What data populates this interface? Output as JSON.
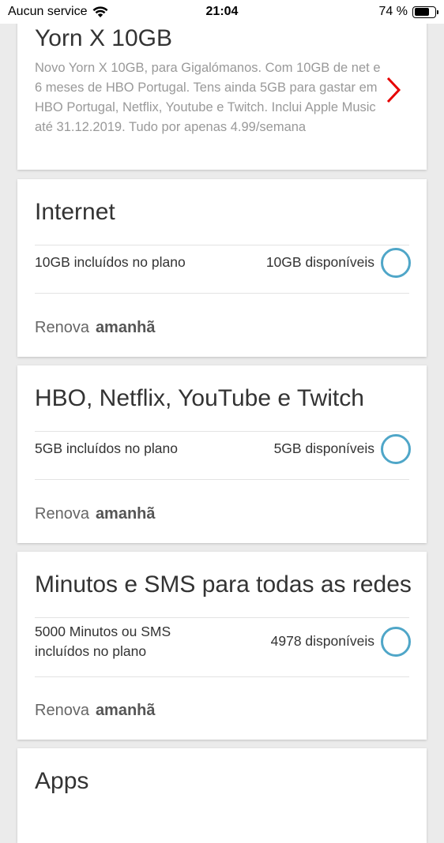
{
  "status_bar": {
    "carrier": "Aucun service",
    "time": "21:04",
    "battery_text": "74 %",
    "battery_level": 0.74
  },
  "plan": {
    "title": "Yorn X 10GB",
    "description": "Novo Yorn X 10GB, para Gigalómanos. Com 10GB de net e 6 meses de HBO Portugal. Tens ainda 5GB para gastar em HBO Portugal, Netflix, Youtube e Twitch. Inclui Apple Music até 31.12.2019. Tudo por apenas 4.99/semana"
  },
  "cards": [
    {
      "title": "Internet",
      "included_line1": "10GB incluídos no plano",
      "included_line2": "",
      "available": "10GB disponíveis",
      "renew_label": "Renova",
      "renew_value": "amanhã"
    },
    {
      "title": "HBO, Netflix, YouTube e Twitch",
      "included_line1": "5GB incluídos no plano",
      "included_line2": "",
      "available": "5GB disponíveis",
      "renew_label": "Renova",
      "renew_value": "amanhã"
    },
    {
      "title": "Minutos e SMS para todas as redes",
      "included_line1": "5000 Minutos ou SMS",
      "included_line2": "incluídos no plano",
      "available": "4978 disponíveis",
      "renew_label": "Renova",
      "renew_value": "amanhã"
    },
    {
      "title": "Apps"
    }
  ],
  "colors": {
    "accent_ring": "#4fa6c8",
    "chevron": "#e60000",
    "background": "#ebebeb"
  }
}
